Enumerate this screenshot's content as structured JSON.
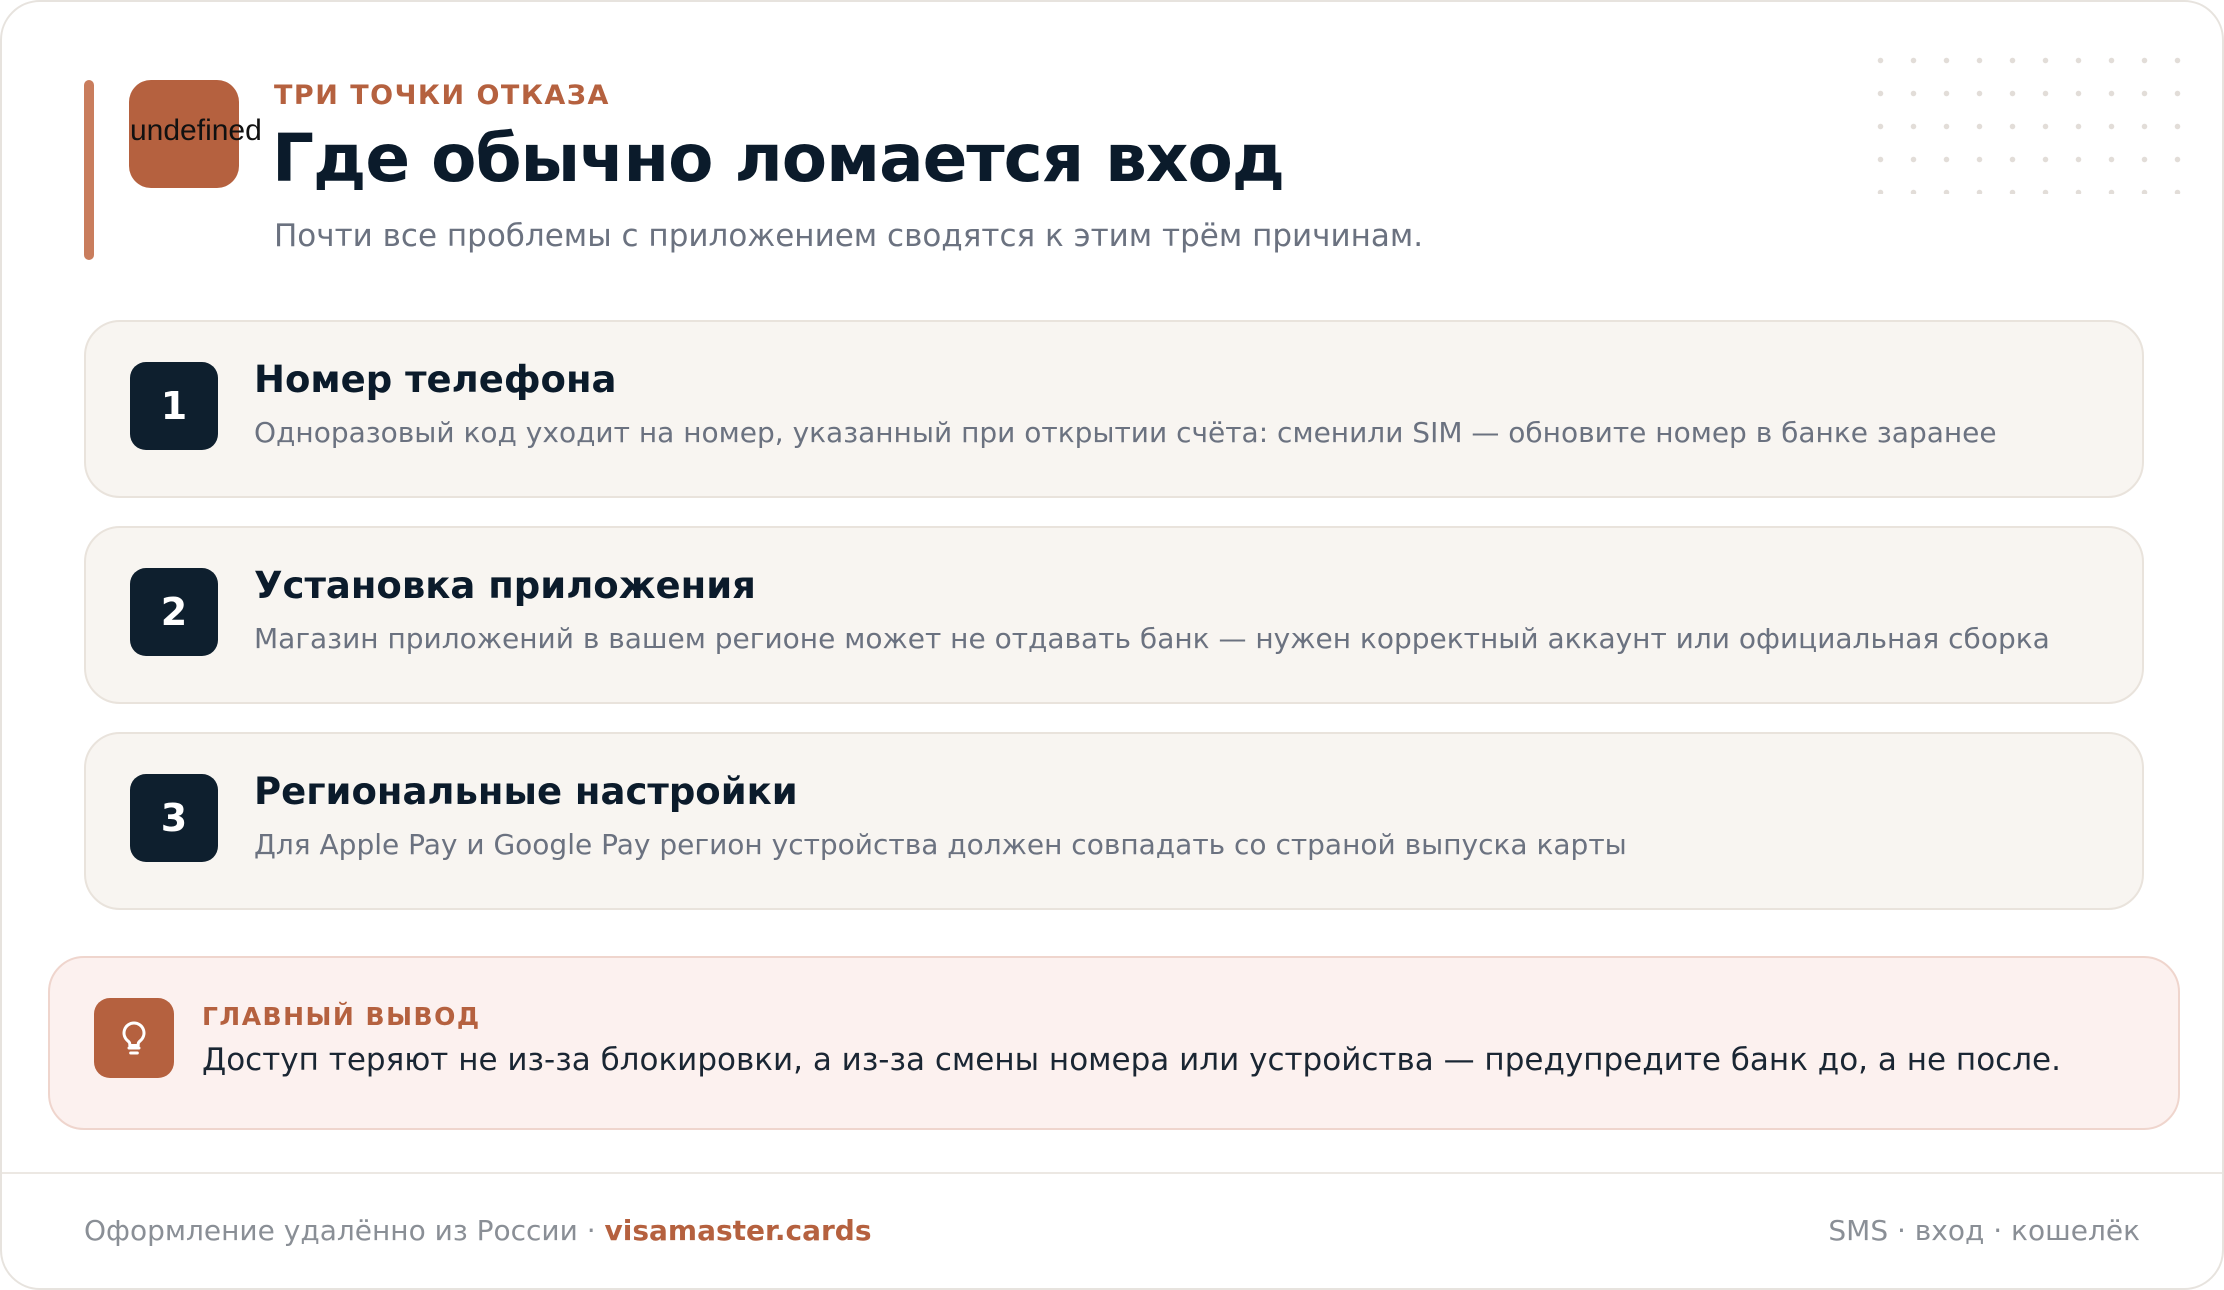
{
  "header": {
    "icon_name": "undefined-icon",
    "icon_text": "undefined",
    "eyebrow": "ТРИ ТОЧКИ ОТКАЗА",
    "title": "Где обычно ломается вход",
    "subtitle": "Почти все проблемы с приложением сводятся к этим трём причинам."
  },
  "cards": [
    {
      "number": "1",
      "title": "Номер телефона",
      "text": "Одноразовый код уходит на номер, указанный при открытии счёта: сменили SIM — обновите номер в банке заранее"
    },
    {
      "number": "2",
      "title": "Установка приложения",
      "text": "Магазин приложений в вашем регионе может не отдавать банк — нужен корректный аккаунт или официальная сборка"
    },
    {
      "number": "3",
      "title": "Региональные настройки",
      "text": "Для Apple Pay и Google Pay регион устройства должен совпадать со страной выпуска карты"
    }
  ],
  "conclusion": {
    "icon_name": "lightbulb-icon",
    "label": "ГЛАВНЫЙ ВЫВОД",
    "text": "Доступ теряют не из-за блокировки, а из-за смены номера или устройства — предупредите банк до, а не после."
  },
  "footer": {
    "left_text": "Оформление удалённо из России · ",
    "link_text": "visamaster.cards",
    "right_text": "SMS · вход · кошелёк"
  },
  "colors": {
    "accent": "#b5613f",
    "dark": "#0e1f2e",
    "card_bg": "#f8f5f1",
    "callout_bg": "#fcf1ef"
  }
}
